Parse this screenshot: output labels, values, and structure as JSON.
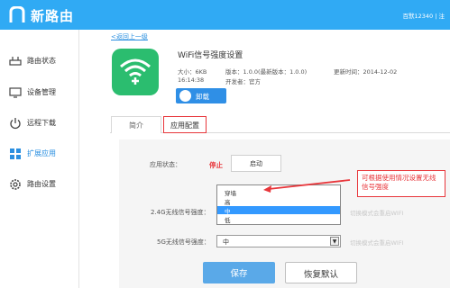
{
  "header": {
    "brand": "新路由",
    "user_text": "百默12340 | 注"
  },
  "sidebar": {
    "items": [
      {
        "label": "路由状态",
        "icon": "router-icon"
      },
      {
        "label": "设备管理",
        "icon": "monitor-icon"
      },
      {
        "label": "远程下载",
        "icon": "power-icon"
      },
      {
        "label": "扩展应用",
        "icon": "apps-grid-icon",
        "active": true
      },
      {
        "label": "路由设置",
        "icon": "gear-icon"
      }
    ]
  },
  "content": {
    "back_link": "<返回上一级",
    "app": {
      "title": "WiFi信号强度设置",
      "size": "大小：6KB",
      "version": "版本：1.0.0(最新版本：1.0.0)",
      "updated": "更新时间：2014-12-02",
      "time": "16:14:38",
      "developer": "开发者：官方",
      "uninstall_label": "卸载"
    },
    "tabs": [
      {
        "label": "简介"
      },
      {
        "label": "应用配置",
        "active": true
      }
    ],
    "config": {
      "status_label": "应用状态：",
      "status_value": "停止",
      "start_button": "启动",
      "wifi24_label": "2.4G无线信号强度：",
      "wifi24_hint": "切换模式会重启WIFI",
      "wifi5_label": "5G无线信号强度：",
      "wifi5_value": "中",
      "wifi5_hint": "切换模式会重启WIFI",
      "dropdown_options": [
        "穿墙",
        "高",
        "中",
        "低"
      ],
      "dropdown_selected_index": 2,
      "callout": "可根据使用情况设置无线信号强度",
      "save_button": "保存",
      "reset_button": "恢复默认"
    }
  },
  "colors": {
    "header_bg": "#30aaf4",
    "accent_blue": "#2f8fe6",
    "app_green": "#2bbd6f",
    "alert_red": "#e8363b"
  }
}
